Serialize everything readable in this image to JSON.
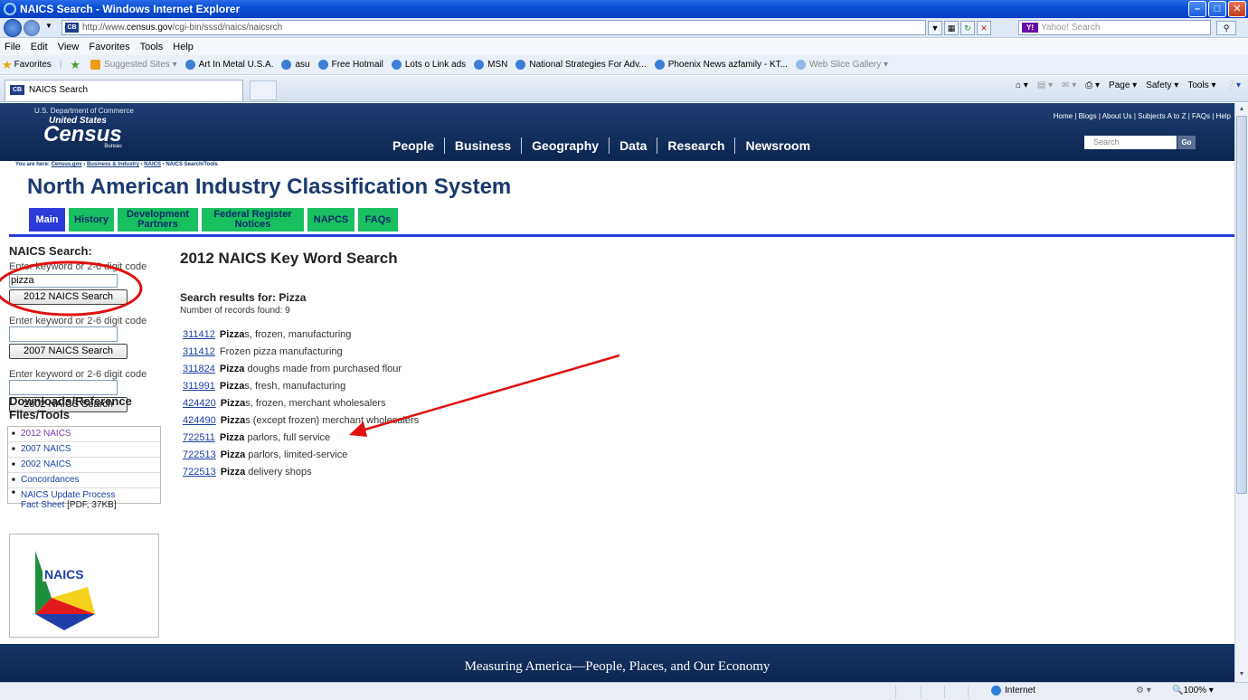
{
  "browser": {
    "window_title": "NAICS Search - Windows Internet Explorer",
    "address": "http://www.census.gov/cgi-bin/sssd/naics/naicsrch",
    "address_host": "census.gov",
    "address_pre": "http://www.",
    "address_post": "/cgi-bin/sssd/naics/naicsrch",
    "search_placeholder": "Yahoo! Search",
    "menu": [
      "File",
      "Edit",
      "View",
      "Favorites",
      "Tools",
      "Help"
    ],
    "favorites_label": "Favorites",
    "favorites": [
      "Suggested Sites ▾",
      "Art In Metal U.S.A.",
      "asu",
      "Free Hotmail",
      "Lots o Link ads",
      "MSN",
      "National Strategies For Adv...",
      "Phoenix News azfamily - KT...",
      "Web Slice Gallery ▾"
    ],
    "tab_title": "NAICS Search",
    "commands": [
      "Page ▾",
      "Safety ▾",
      "Tools ▾"
    ],
    "status_zone": "Internet",
    "zoom": "100%"
  },
  "site": {
    "dept": "U.S. Department of Commerce",
    "logo_top": "United States",
    "logo_main": "Census",
    "logo_bottom": "Bureau",
    "nav": [
      "People",
      "Business",
      "Geography",
      "Data",
      "Research",
      "Newsroom"
    ],
    "toplinks": "Home | Blogs | About Us | Subjects A to Z | FAQs | Help",
    "search_placeholder": "Search",
    "go": "Go",
    "breadcrumb_prefix": "You are here:",
    "breadcrumb": [
      "Census.gov",
      "Business & Industry",
      "NAICS"
    ],
    "breadcrumb_current": "NAICS Search/Tools",
    "page_title": "North American Industry Classification System",
    "footer": "Measuring America—People, Places, and Our Economy"
  },
  "tabs": [
    {
      "label": "Main",
      "active": true
    },
    {
      "label": "History",
      "active": false
    },
    {
      "label": "Development Partners",
      "active": false
    },
    {
      "label": "Federal Register Notices",
      "active": false
    },
    {
      "label": "NAPCS",
      "active": false
    },
    {
      "label": "FAQs",
      "active": false
    }
  ],
  "left": {
    "heading": "NAICS Search:",
    "prompt": "Enter keyword or 2-6 digit code",
    "search2012_value": "pizza",
    "btn2012": "2012 NAICS Search",
    "btn2007": "2007 NAICS Search",
    "btn2002": "2002 NAICS Search",
    "downloads_heading_1": "Downloads/Reference",
    "downloads_heading_2": "Files/Tools",
    "downloads": [
      "2012 NAICS",
      "2007 NAICS",
      "2002 NAICS",
      "Concordances",
      "NAICS Update Process"
    ],
    "downloads_last_line2": "Fact Sheet",
    "downloads_last_note": "[PDF, 37KB]",
    "logo_text": "NAICS"
  },
  "results": {
    "title": "2012 NAICS Key Word Search",
    "search_for": "Search results for: Pizza",
    "count": "Number of records found: 9",
    "items": [
      {
        "code": "311412",
        "bold": "Pizza",
        "rest": "s, frozen, manufacturing"
      },
      {
        "code": "311412",
        "bold": "",
        "rest": "Frozen pizza manufacturing"
      },
      {
        "code": "311824",
        "bold": "Pizza",
        "rest": " doughs made from purchased flour"
      },
      {
        "code": "311991",
        "bold": "Pizza",
        "rest": "s, fresh, manufacturing"
      },
      {
        "code": "424420",
        "bold": "Pizza",
        "rest": "s, frozen, merchant wholesalers"
      },
      {
        "code": "424490",
        "bold": "Pizza",
        "rest": "s (except frozen) merchant wholesalers"
      },
      {
        "code": "722511",
        "bold": "Pizza",
        "rest": " parlors, full service"
      },
      {
        "code": "722513",
        "bold": "Pizza",
        "rest": " parlors, limited-service"
      },
      {
        "code": "722513",
        "bold": "Pizza",
        "rest": " delivery shops"
      }
    ]
  },
  "colors": {
    "annotation": "#e01010",
    "tab_green": "#18c05f",
    "tab_active": "#2b3bd9",
    "header_navy": "#0b2550"
  }
}
